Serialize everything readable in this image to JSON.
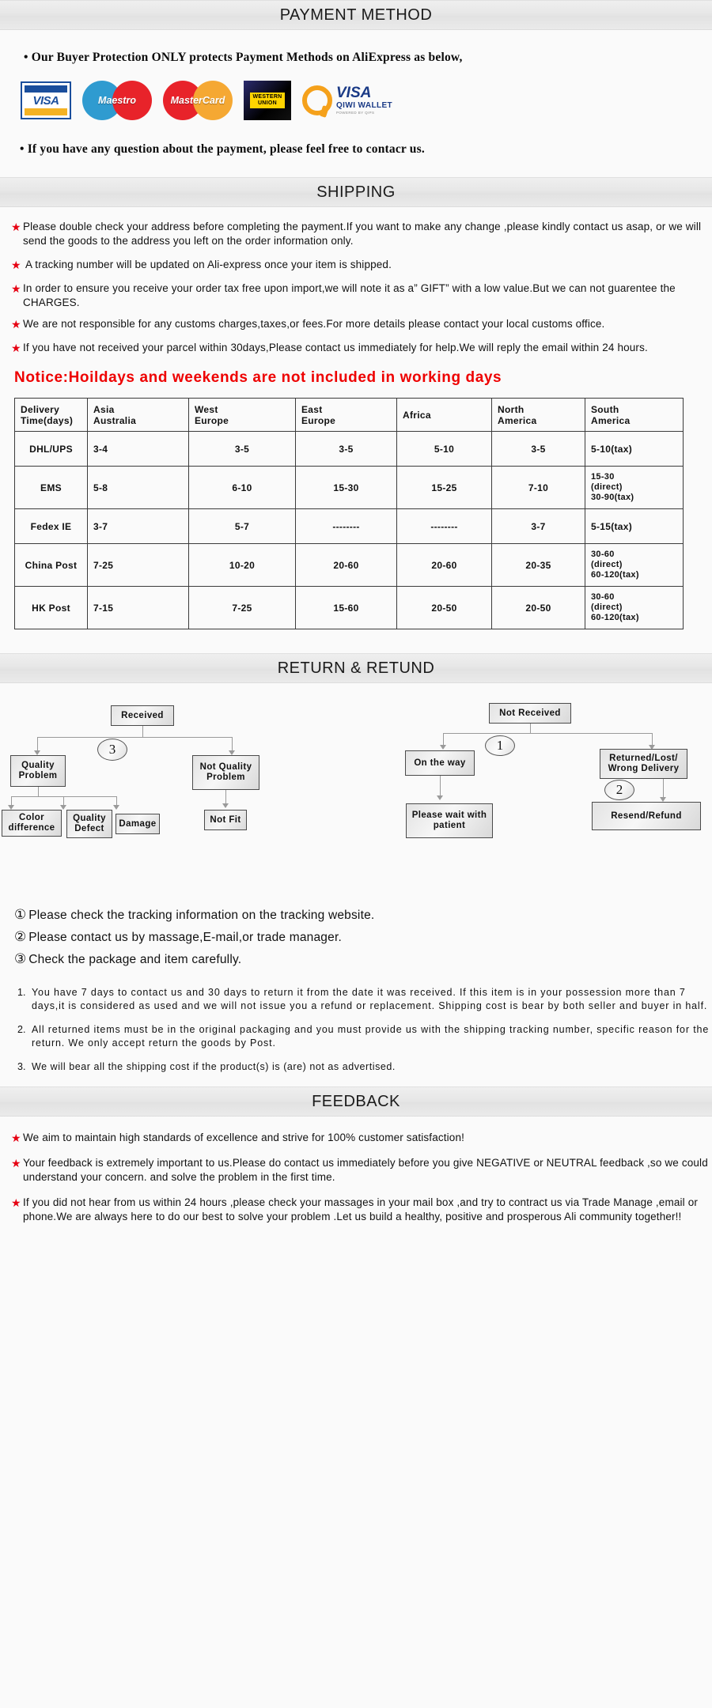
{
  "sections": {
    "payment": "PAYMENT METHOD",
    "shipping": "SHIPPING",
    "return": "RETURN & RETUND",
    "feedback": "FEEDBACK"
  },
  "payment": {
    "intro": "•  Our Buyer Protection ONLY protects Payment Methods on AliExpress as below,",
    "outro": "• If you have any question about the payment, please feel free to contacr us.",
    "logos": [
      {
        "name": "visa-logo",
        "text": "VISA"
      },
      {
        "name": "maestro-logo",
        "text": "Maestro"
      },
      {
        "name": "mastercard-logo",
        "text": "MasterCard"
      },
      {
        "name": "western-union-logo",
        "line1": "WESTERN",
        "line2": "UNION"
      },
      {
        "name": "qiwi-wallet-logo",
        "visa": "VISA",
        "wallet": "QIWI WALLET",
        "powered": "POWERED BY QIPS"
      }
    ]
  },
  "shipping": {
    "bullets": [
      "Please double check your address before completing the payment.If you want to make any change ,please kindly contact us asap, or we will send the goods to the address you left on the order information only.",
      "A tracking number will be updated on Ali-express once your item is shipped.",
      "In order to ensure you receive your order tax free upon import,we will note it as a” GIFT” with a low value.But we can not guarentee the CHARGES.",
      "We are not responsible for any customs charges,taxes,or fees.For more details please contact your local customs office.",
      "If you have not received your parcel within 30days,Please contact us immediately for help.We will reply the email within 24 hours."
    ],
    "notice": "Notice:Hoildays and weekends are not included in working days",
    "table": {
      "headers": [
        "Delivery Time(days)",
        "Asia Australia",
        "West Europe",
        "East Europe",
        "Africa",
        "North America",
        "South America"
      ],
      "rows": [
        {
          "method": "DHL/UPS",
          "cells": [
            "3-4",
            "3-5",
            "3-5",
            "5-10",
            "3-5",
            "5-10(tax)"
          ]
        },
        {
          "method": "EMS",
          "cells": [
            "5-8",
            "6-10",
            "15-30",
            "15-25",
            "7-10",
            "15-30 (direct) 30-90(tax)"
          ]
        },
        {
          "method": "Fedex IE",
          "cells": [
            "3-7",
            "5-7",
            "--------",
            "--------",
            "3-7",
            "5-15(tax)"
          ]
        },
        {
          "method": "China Post",
          "cells": [
            "7-25",
            "10-20",
            "20-60",
            "20-60",
            "20-35",
            "30-60 (direct) 60-120(tax)"
          ]
        },
        {
          "method": "HK Post",
          "cells": [
            "7-15",
            "7-25",
            "15-60",
            "20-50",
            "20-50",
            "30-60 (direct) 60-120(tax)"
          ]
        }
      ]
    }
  },
  "flowchart": {
    "left": {
      "root": "Received",
      "badge": "3",
      "branch_a": "Quality Problem",
      "branch_b": "Not Quality Problem",
      "leaves_a": [
        "Color difference",
        "Quality Defect",
        "Damage"
      ],
      "leaf_b": "Not Fit"
    },
    "right": {
      "root": "Not  Received",
      "badge_1": "1",
      "badge_2": "2",
      "branch_a": "On the way",
      "branch_b": "Returned/Lost/ Wrong Delivery",
      "leaf_a": "Please wait with patient",
      "leaf_b": "Resend/Refund"
    }
  },
  "return_notes": [
    {
      "num": "①",
      "text": "Please check the tracking information on the tracking website."
    },
    {
      "num": "②",
      "text": "Please contact us by  massage,E-mail,or trade manager."
    },
    {
      "num": "③",
      "text": "Check the package and item carefully."
    }
  ],
  "return_policy": [
    {
      "num": "1.",
      "text": "You have 7 days to contact us and 30 days to return it from the date it was received. If this item is in your possession more than 7 days,it is considered as used and we will not issue you a refund or replacement. Shipping cost is bear by both seller and buyer in half."
    },
    {
      "num": "2.",
      "text": "All returned items must be in the original packaging and you must provide us with the shipping tracking number, specific reason for the return. We only accept return the goods by Post."
    },
    {
      "num": "3.",
      "text": "We will bear all the shipping cost if the product(s) is (are) not as advertised."
    }
  ],
  "feedback": {
    "bullets": [
      "We aim to maintain high standards of excellence and strive  for 100% customer satisfaction!",
      "Your feedback is extremely important to us.Please do contact us immediately before you give NEGATIVE or NEUTRAL feedback ,so  we could understand your concern. and solve the problem in the first time.",
      "If you did not hear from us within 24 hours ,please check your massages in your mail box ,and try to contract us via Trade Manage ,email or phone.We are always here to do our best to solve your problem .Let us build a healthy, positive and prosperous Ali community together!!"
    ]
  },
  "colors": {
    "star": "#e60012",
    "notice": "#ee0000",
    "banner": "#e7e7e7"
  }
}
